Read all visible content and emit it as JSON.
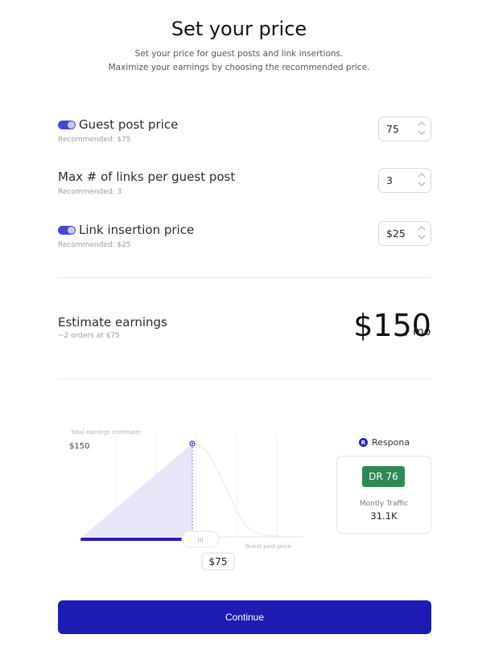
{
  "header": {
    "title": "Set your price",
    "subtitle_line1": "Set your price for guest posts and link insertions.",
    "subtitle_line2": "Maximize your earnings by choosing the recommended price."
  },
  "settings": {
    "guest_post": {
      "label": "Guest post price",
      "recommended": "Recommended: $75",
      "value": "75",
      "toggle_on": true
    },
    "max_links": {
      "label": "Max # of links per guest post",
      "recommended": "Recommended: 3",
      "value": "3"
    },
    "link_insertion": {
      "label": "Link insertion price",
      "recommended": "Recommended: $25",
      "value": "$25",
      "toggle_on": true
    }
  },
  "estimate": {
    "label": "Estimate earnings",
    "sub": "~2 orders at $75",
    "value": "$150",
    "unit": "/ mo"
  },
  "chart": {
    "ylabel": "Total earnings (estimate)",
    "peak_label": "$150",
    "xlabel": "Guest post price",
    "slider_value": "$75",
    "handle_glyph": "III"
  },
  "site": {
    "brand": "Respona",
    "brand_initial": "R",
    "dr": "DR 76",
    "traffic_label": "Montly Traffic",
    "traffic_value": "31.1K"
  },
  "actions": {
    "continue": "Continue"
  },
  "colors": {
    "accent": "#1f1cb5",
    "toggle": "#4847d3",
    "dr_badge": "#2d8a56",
    "chart_fill": "#e8e7f8"
  }
}
